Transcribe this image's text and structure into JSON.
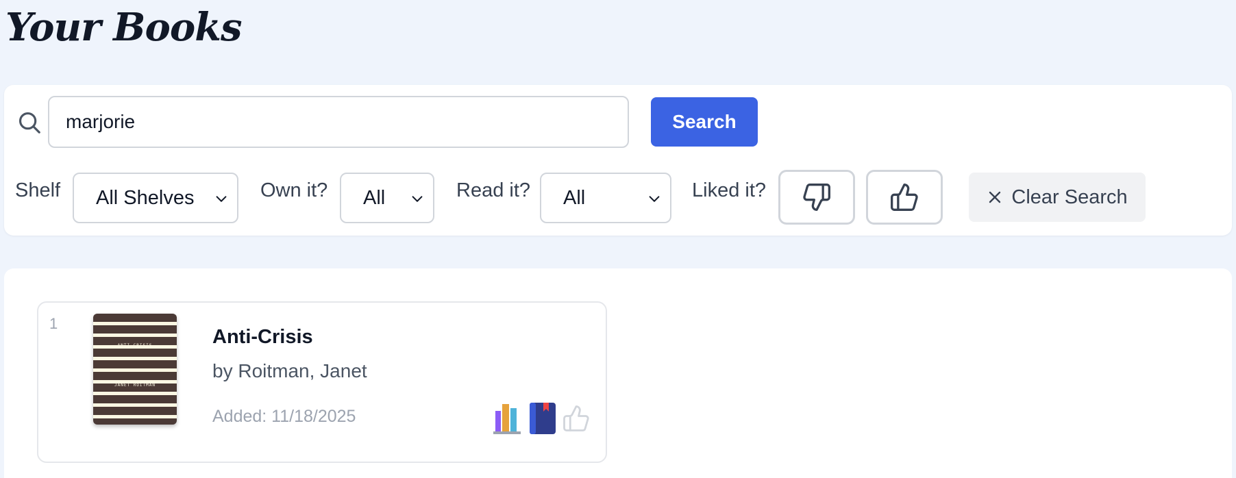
{
  "page": {
    "title": "Your Books"
  },
  "search": {
    "value": "marjorie",
    "button_label": "Search"
  },
  "filters": {
    "shelf": {
      "label": "Shelf",
      "selected": "All Shelves"
    },
    "own": {
      "label": "Own it?",
      "selected": "All"
    },
    "read": {
      "label": "Read it?",
      "selected": "All"
    },
    "liked": {
      "label": "Liked it?"
    },
    "clear_label": "Clear Search"
  },
  "results": [
    {
      "index": "1",
      "title": "Anti-Crisis",
      "author": "by Roitman, Janet",
      "added": "Added: 11/18/2025",
      "cover_title": "ANTI-CRISIS",
      "cover_author": "JANET ROITMAN",
      "status_icons": [
        "shelves-icon",
        "book-icon",
        "thumbs-up-icon"
      ]
    }
  ],
  "colors": {
    "background": "#eff4fc",
    "accent": "#3b63e3",
    "cover_stripe": "#4b3a36"
  }
}
